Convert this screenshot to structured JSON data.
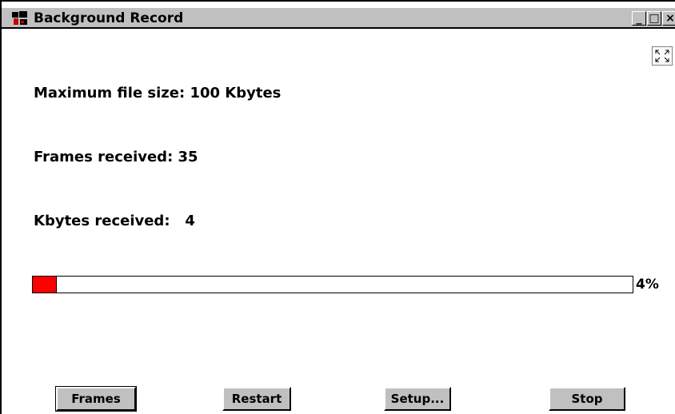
{
  "window": {
    "title": "Background Record",
    "controls": {
      "minimize": "_",
      "maximize": "□",
      "close": "×"
    }
  },
  "info": {
    "max_file_size": "Maximum file size: 100 Kbytes",
    "frames_received": "Frames received: 35",
    "kbytes_received": "Kbytes received:   4"
  },
  "progress": {
    "percent_label": "4%",
    "fraction": 0.04,
    "fill_color": "#ff0000"
  },
  "buttons": {
    "frames": "Frames",
    "restart": "Restart",
    "setup": "Setup...",
    "stop": "Stop"
  },
  "icons": {
    "app": "app-logo-icon",
    "expand": "expand-icon"
  }
}
